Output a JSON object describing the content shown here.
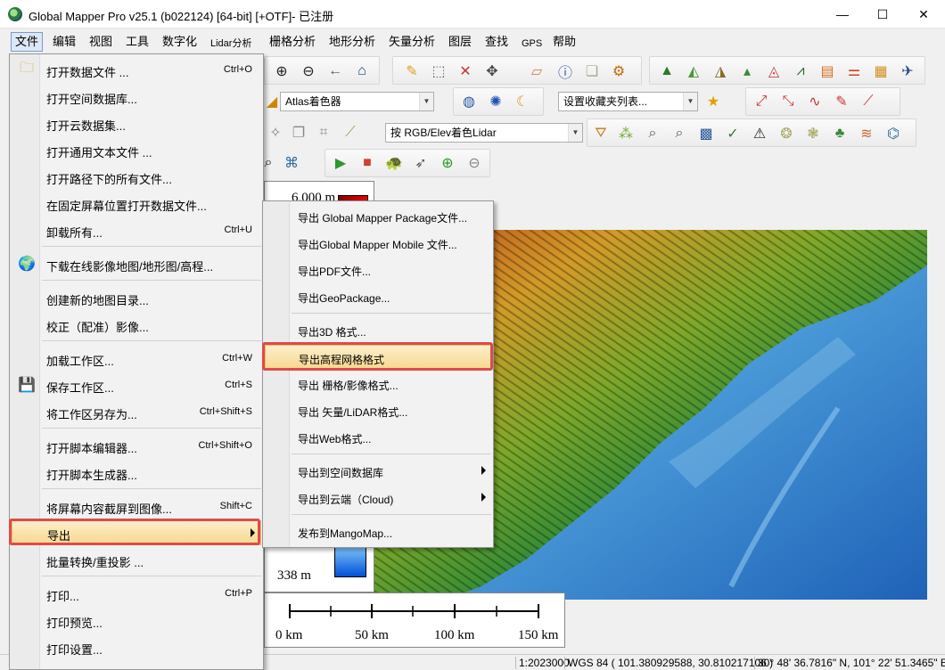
{
  "window": {
    "title": "Global Mapper Pro v25.1 (b022124) [64-bit] [+OTF]- 已注册",
    "min_glyph": "—",
    "max_glyph": "☐",
    "close_glyph": "✕"
  },
  "menubar": [
    "文件",
    "编辑",
    "视图",
    "工具",
    "数字化",
    "Lidar分析",
    "栅格分析",
    "地形分析",
    "矢量分析",
    "图层",
    "查找",
    "GPS",
    "帮助"
  ],
  "toolbar": {
    "shader_combo": "Atlas着色器",
    "favorites_combo": "设置收藏夹列表...",
    "lidar_combo": "按 RGB/Elev着色Lidar"
  },
  "file_menu": {
    "items": [
      {
        "label": "打开数据文件 ...",
        "shortcut": "Ctrl+O",
        "icon": "folder-icon"
      },
      {
        "label": "打开空间数据库...",
        "shortcut": ""
      },
      {
        "label": "打开云数据集...",
        "shortcut": ""
      },
      {
        "label": "打开通用文本文件 ...",
        "shortcut": ""
      },
      {
        "label": "打开路径下的所有文件...",
        "shortcut": ""
      },
      {
        "label": "在固定屏幕位置打开数据文件...",
        "shortcut": ""
      },
      {
        "label": "卸载所有...",
        "shortcut": "Ctrl+U"
      },
      {
        "label": "下载在线影像地图/地形图/高程...",
        "shortcut": "",
        "icon": "globe-icon"
      },
      {
        "label": "创建新的地图目录...",
        "shortcut": ""
      },
      {
        "label": "校正（配准）影像...",
        "shortcut": ""
      },
      {
        "label": "加载工作区...",
        "shortcut": "Ctrl+W"
      },
      {
        "label": "保存工作区...",
        "shortcut": "Ctrl+S",
        "icon": "save-icon"
      },
      {
        "label": "将工作区另存为...",
        "shortcut": "Ctrl+Shift+S"
      },
      {
        "label": "打开脚本编辑器...",
        "shortcut": "Ctrl+Shift+O"
      },
      {
        "label": "打开脚本生成器...",
        "shortcut": ""
      },
      {
        "label": "将屏幕内容截屏到图像...",
        "shortcut": "Shift+C"
      },
      {
        "label": "导出",
        "shortcut": "",
        "submenu": true,
        "highlighted": true
      },
      {
        "label": "批量转换/重投影 ...",
        "shortcut": ""
      },
      {
        "label": "打印...",
        "shortcut": "Ctrl+P"
      },
      {
        "label": "打印预览...",
        "shortcut": ""
      },
      {
        "label": "打印设置...",
        "shortcut": ""
      }
    ]
  },
  "export_menu": {
    "items": [
      {
        "label": "导出 Global Mapper Package文件..."
      },
      {
        "label": "导出Global Mapper Mobile 文件..."
      },
      {
        "label": "导出PDF文件..."
      },
      {
        "label": "导出GeoPackage..."
      },
      {
        "label": "导出3D 格式..."
      },
      {
        "label": "导出高程网格格式",
        "highlighted": true
      },
      {
        "label": "导出 栅格/影像格式..."
      },
      {
        "label": "导出 矢量/LiDAR格式..."
      },
      {
        "label": "导出Web格式..."
      },
      {
        "label": "导出到空间数据库",
        "submenu": true
      },
      {
        "label": "导出到云端（Cloud)",
        "submenu": true
      },
      {
        "label": "发布到MangoMap..."
      }
    ]
  },
  "legend": {
    "top_label": "6,000 m",
    "bottom_label": "338 m"
  },
  "scalebar": {
    "labels": [
      "0 km",
      "50 km",
      "100 km",
      "150 km"
    ]
  },
  "statusbar": {
    "scale": "1:2023000",
    "coords": "WGS 84 ( 101.380929588, 30.810217106 )",
    "dms": "30° 48' 36.7816\" N, 101° 22' 51.3465\" E"
  },
  "colors": {
    "highlight_red": "#e04a4a",
    "menu_highlight": "#f6d98e",
    "water_blue": "#3a86c8"
  }
}
